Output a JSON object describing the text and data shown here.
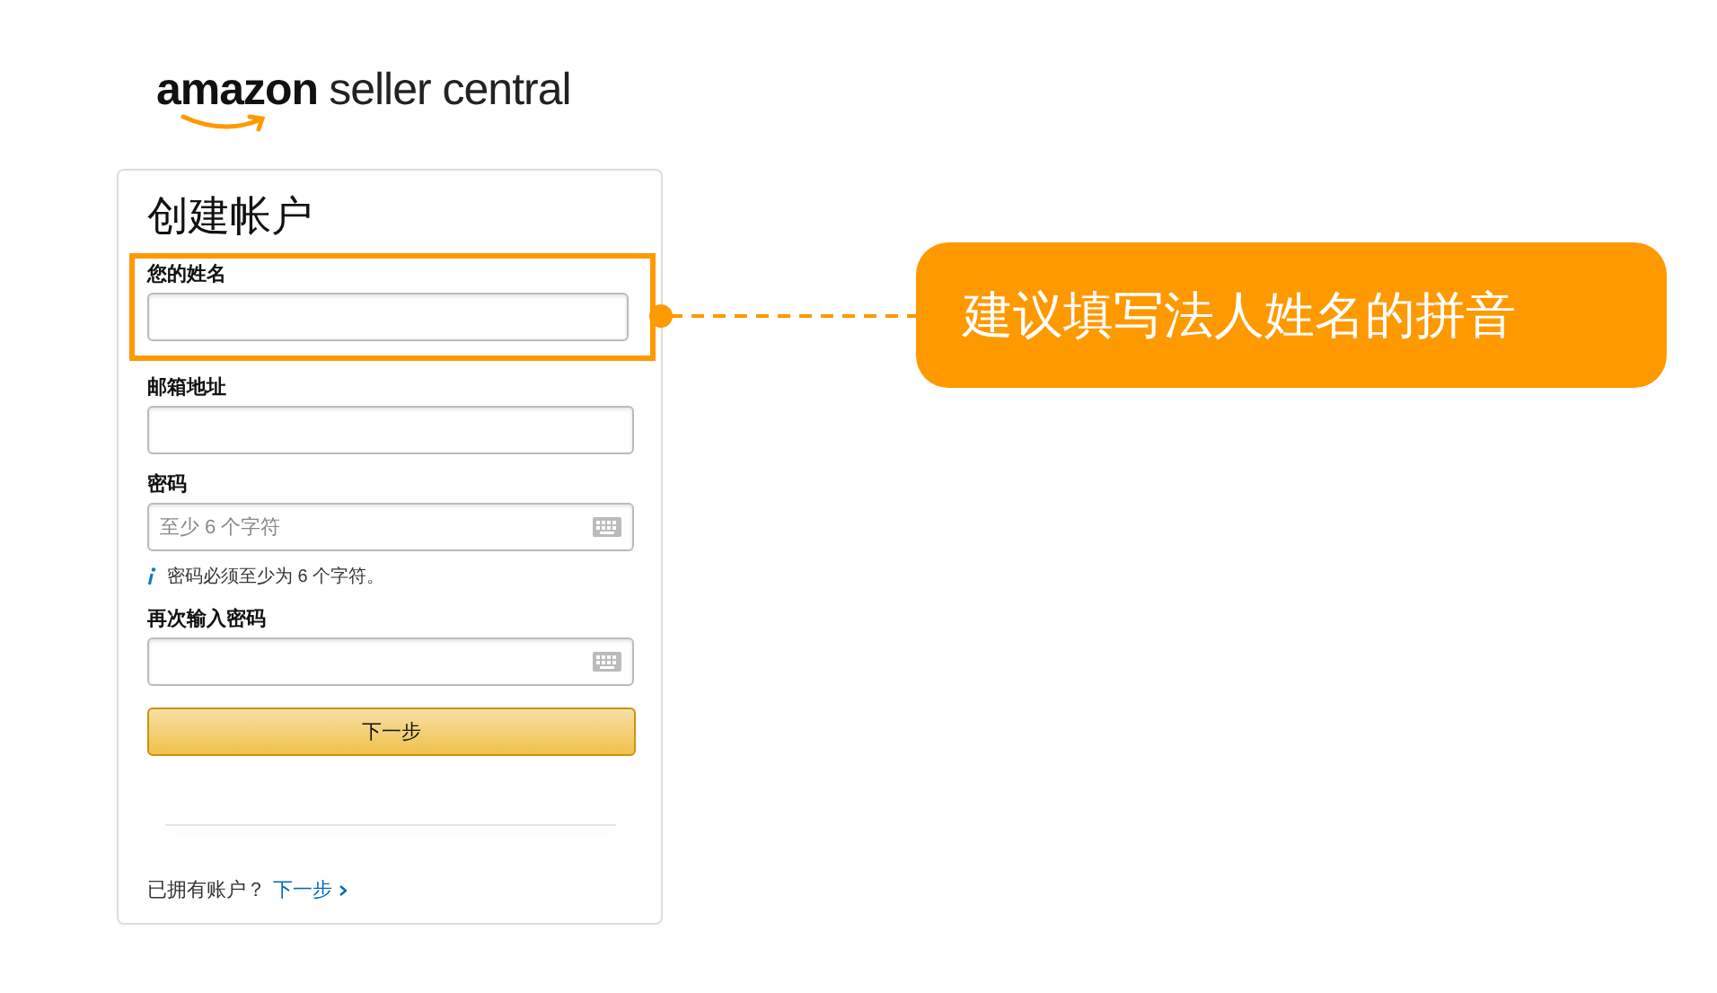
{
  "logo": {
    "brand": "amazon",
    "product": "seller central"
  },
  "form": {
    "title": "创建帐户",
    "fields": [
      {
        "label": "您的姓名",
        "kind": "text",
        "highlighted": true
      },
      {
        "label": "邮箱地址",
        "kind": "text",
        "highlighted": false
      },
      {
        "label": "密码",
        "kind": "password",
        "placeholder": "至少 6 个字符",
        "hint": "密码必须至少为 6 个字符。",
        "highlighted": false
      },
      {
        "label": "再次输入密码",
        "kind": "password",
        "highlighted": false
      }
    ],
    "submit_button": "下一步",
    "footer_text": "已拥有账户？",
    "footer_link": "下一步"
  },
  "callout": {
    "text": "建议填写法人姓名的拼音"
  }
}
